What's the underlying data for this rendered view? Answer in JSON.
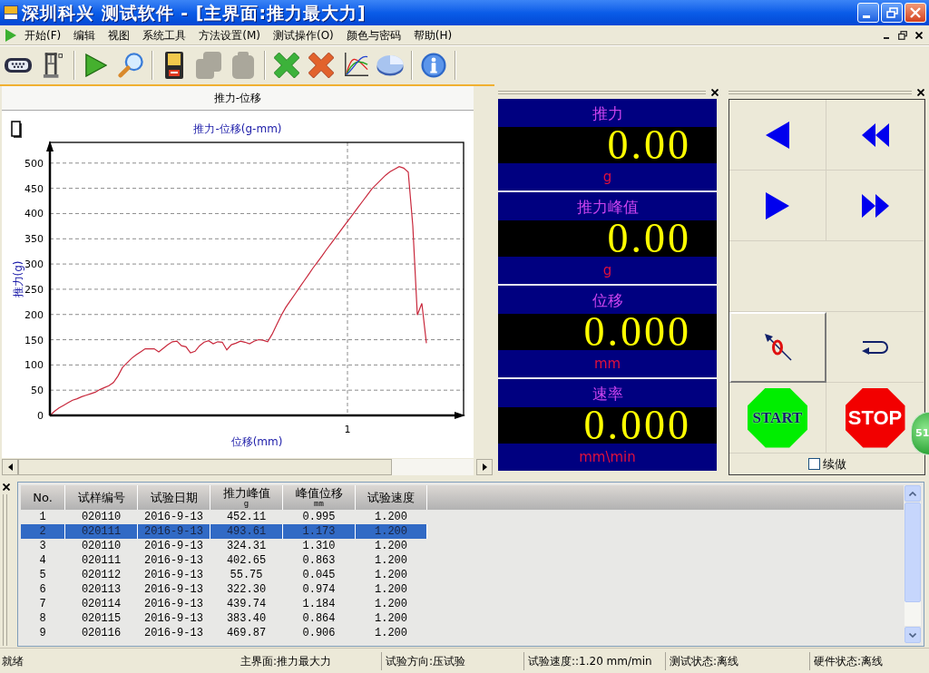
{
  "window": {
    "title": "深圳科兴 测试软件 - [主界面:推力最大力]"
  },
  "menu": [
    "开始(F)",
    "编辑",
    "视图",
    "系统工具",
    "方法设置(M)",
    "测试操作(O)",
    "颜色与密码",
    "帮助(H)"
  ],
  "toolbar": [
    [
      {
        "kind": "port",
        "disabled": false
      },
      {
        "kind": "tester",
        "disabled": false
      }
    ],
    [
      {
        "kind": "run",
        "disabled": false
      },
      {
        "kind": "search",
        "disabled": false
      }
    ],
    [
      {
        "kind": "save",
        "disabled": false
      },
      {
        "kind": "copy",
        "disabled": true
      },
      {
        "kind": "paste",
        "disabled": true
      }
    ],
    [
      {
        "kind": "clear",
        "disabled": false
      },
      {
        "kind": "delete",
        "disabled": false
      },
      {
        "kind": "curves",
        "disabled": false
      },
      {
        "kind": "pie",
        "disabled": false
      }
    ],
    [
      {
        "kind": "info",
        "disabled": false
      }
    ]
  ],
  "chart_panel": {
    "title": "推力-位移",
    "chart_data": {
      "type": "line",
      "title": "推力-位移(g-mm)",
      "xlabel": "位移(mm)",
      "ylabel": "推力(g)",
      "grid": true,
      "series": [
        {
          "color": "#c8283c",
          "values": [
            0,
            8,
            15,
            20,
            25,
            30,
            33,
            37,
            40,
            43,
            46,
            51,
            55,
            59,
            65,
            78,
            95,
            104,
            113,
            120,
            126,
            132,
            132,
            132,
            126,
            133,
            140,
            146,
            147,
            138,
            136,
            124,
            127,
            138,
            145,
            148,
            142,
            146,
            145,
            130,
            140,
            143,
            147,
            145,
            142,
            147,
            150,
            149,
            146,
            161,
            180,
            198,
            214,
            227,
            240,
            253,
            266,
            279,
            292,
            304,
            316,
            329,
            341,
            353,
            365,
            377,
            389,
            401,
            413,
            425,
            437,
            449,
            458,
            467,
            476,
            483,
            488,
            493,
            490,
            482,
            376,
            199,
            222,
            143
          ]
        }
      ],
      "ylim": [
        0,
        541
      ],
      "yticks": [
        0,
        50,
        100,
        150,
        200,
        250,
        300,
        350,
        400,
        450,
        500
      ],
      "annotations": [
        "1"
      ]
    }
  },
  "readouts": [
    {
      "label": "推力",
      "value": "0.00",
      "unit": "g"
    },
    {
      "label": "推力峰值",
      "value": "0.00",
      "unit": "g"
    },
    {
      "label": "位移",
      "value": "0.000",
      "unit": "mm"
    },
    {
      "label": "速率",
      "value": "0.000",
      "unit": "mm\\min"
    }
  ],
  "controls": {
    "buttons": [
      {
        "kind": "step-back",
        "raised": false
      },
      {
        "kind": "fast-back",
        "raised": false
      },
      {
        "kind": "step-forward",
        "raised": false
      },
      {
        "kind": "fast-forward",
        "raised": false
      },
      {
        "kind": "blank",
        "raised": false
      },
      {
        "kind": "zero",
        "raised": true
      },
      {
        "kind": "return",
        "raised": false
      },
      {
        "kind": "start",
        "label": "START",
        "raised": false
      },
      {
        "kind": "stop",
        "label": "STOP",
        "raised": false
      }
    ],
    "continue_option": {
      "label": "续做",
      "checked": false
    }
  },
  "floating_ball": {
    "label": "51"
  },
  "table": {
    "columns": [
      {
        "label": "No."
      },
      {
        "label": "试样编号"
      },
      {
        "label": "试验日期"
      },
      {
        "label": "推力峰值",
        "unit": "g"
      },
      {
        "label": "峰值位移",
        "unit": "mm"
      },
      {
        "label": "试验速度"
      }
    ],
    "rows": [
      {
        "cells": [
          "1",
          "020110",
          "2016-9-13",
          "452.11",
          "0.995",
          "1.200"
        ],
        "selected": false
      },
      {
        "cells": [
          "2",
          "020111",
          "2016-9-13",
          "493.61",
          "1.173",
          "1.200"
        ],
        "selected": true
      },
      {
        "cells": [
          "3",
          "020110",
          "2016-9-13",
          "324.31",
          "1.310",
          "1.200"
        ],
        "selected": false
      },
      {
        "cells": [
          "4",
          "020111",
          "2016-9-13",
          "402.65",
          "0.863",
          "1.200"
        ],
        "selected": false
      },
      {
        "cells": [
          "5",
          "020112",
          "2016-9-13",
          "55.75",
          "0.045",
          "1.200"
        ],
        "selected": false
      },
      {
        "cells": [
          "6",
          "020113",
          "2016-9-13",
          "322.30",
          "0.974",
          "1.200"
        ],
        "selected": false
      },
      {
        "cells": [
          "7",
          "020114",
          "2016-9-13",
          "439.74",
          "1.184",
          "1.200"
        ],
        "selected": false
      },
      {
        "cells": [
          "8",
          "020115",
          "2016-9-13",
          "383.40",
          "0.864",
          "1.200"
        ],
        "selected": false
      },
      {
        "cells": [
          "9",
          "020116",
          "2016-9-13",
          "469.87",
          "0.906",
          "1.200"
        ],
        "selected": false
      }
    ]
  },
  "status_bar": [
    "就绪",
    "主界面:推力最大力",
    "试验方向:压试验",
    "试验速度::1.20 mm/min",
    "测试状态:离线",
    "硬件状态:离线"
  ]
}
